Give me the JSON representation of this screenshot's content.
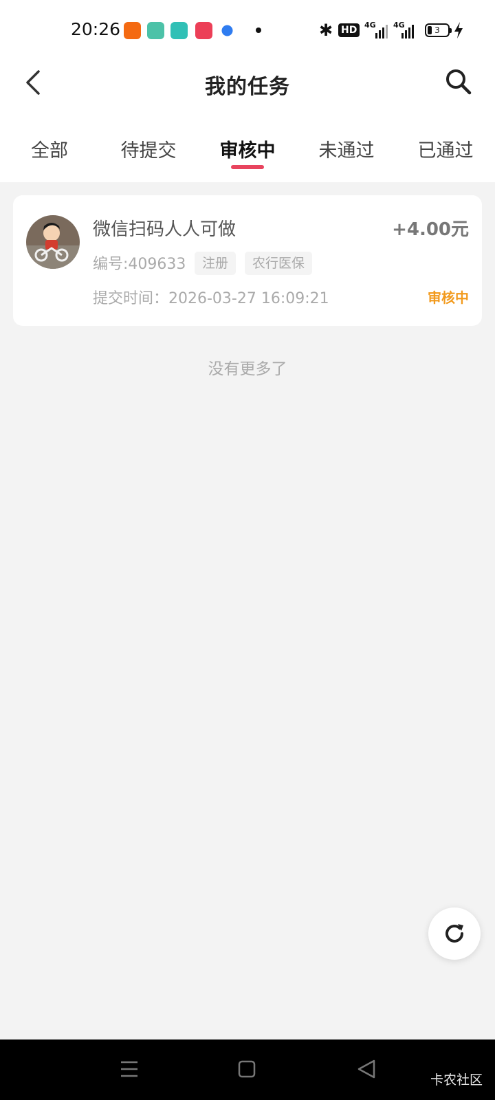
{
  "status_bar": {
    "time": "20:26",
    "network_label": "HD",
    "signal_1_label": "4G",
    "signal_2_label": "4G",
    "battery_level": "3",
    "app_icons": [
      "video-app-icon",
      "download-app-icon",
      "chat-app-icon",
      "play-app-icon",
      "browser-app-icon"
    ]
  },
  "header": {
    "title": "我的任务"
  },
  "tabs": [
    {
      "label": "全部",
      "active": false
    },
    {
      "label": "待提交",
      "active": false
    },
    {
      "label": "审核中",
      "active": true
    },
    {
      "label": "未通过",
      "active": false
    },
    {
      "label": "已通过",
      "active": false
    }
  ],
  "tasks": [
    {
      "name": "微信扫码人人可做",
      "reward": "+4.00元",
      "id_text": "编号:409633",
      "tags": [
        "注册",
        "农行医保"
      ],
      "submit_time": "提交时间：2026-03-27 16:09:21",
      "status": "审核中"
    }
  ],
  "list_end_text": "没有更多了",
  "watermark": "卡农社区",
  "colors": {
    "accent": "#e8445e",
    "status_pending": "#f29a1d",
    "background": "#f3f3f3"
  }
}
